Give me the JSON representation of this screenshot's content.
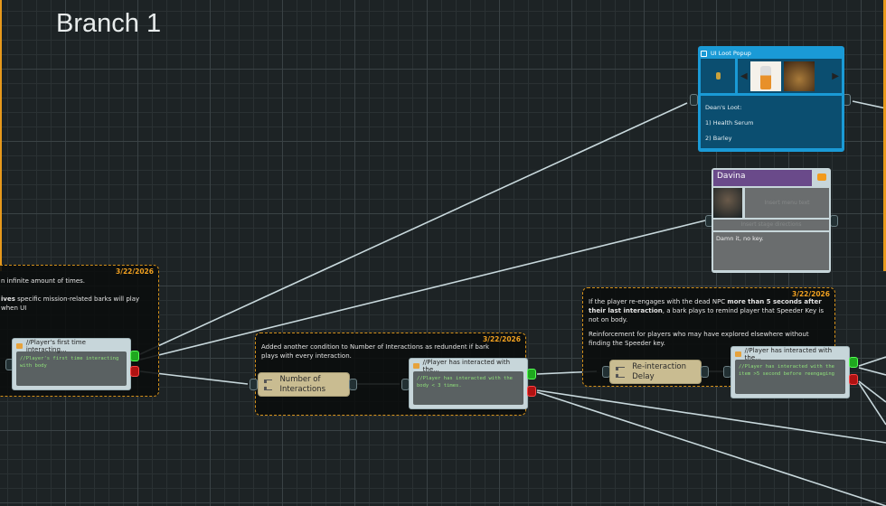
{
  "canvas_title": "Branch 1",
  "comments": [
    {
      "date": "3/22/2026",
      "line1": "n infinite amount of times.",
      "line2_bold": "ives",
      "line2": " specific mission-related barks will play when UI"
    },
    {
      "date": "3/22/2026",
      "text": "Added another condition to Number of Interactions as redundent if bark plays with every interaction."
    },
    {
      "date": "3/22/2026",
      "p1_a": "If the player re-engages with the dead NPC ",
      "p1_bold1": "more than 5 seconds after their last interaction",
      "p1_b": ", a bark plays to remind player that Speeder Key is not on body.",
      "p2": "Reinforcement for players who may have explored elsewhere without finding the Speeder key."
    }
  ],
  "fragments": [
    {
      "title": "//Player's first time interacting...",
      "body": "//Player's first time interacting with body"
    },
    {
      "title": "//Player has interacted with the...",
      "body": "//Player has interacted with the body < 3 times."
    },
    {
      "title": "//Player has interacted with the...",
      "body": "//Player has interacted with the item >5 second before reengaging"
    }
  ],
  "conditions": [
    {
      "label": "Number of Interactions"
    },
    {
      "label": "Re-interaction Delay"
    }
  ],
  "loot_popup": {
    "title": "UI Loot Popup",
    "text_lines": [
      "Dean's Loot:",
      "1) Health Serum",
      "2) Barley"
    ]
  },
  "dialogue": {
    "speaker": "Davina",
    "menu_placeholder": "Insert menu text",
    "stage_placeholder": "Insert stage directions",
    "text": "Damn it, no key.",
    "speaker_color": "#6a4a8a"
  },
  "colors": {
    "accent": "#f0a020",
    "loot": "#1a9ad6"
  }
}
